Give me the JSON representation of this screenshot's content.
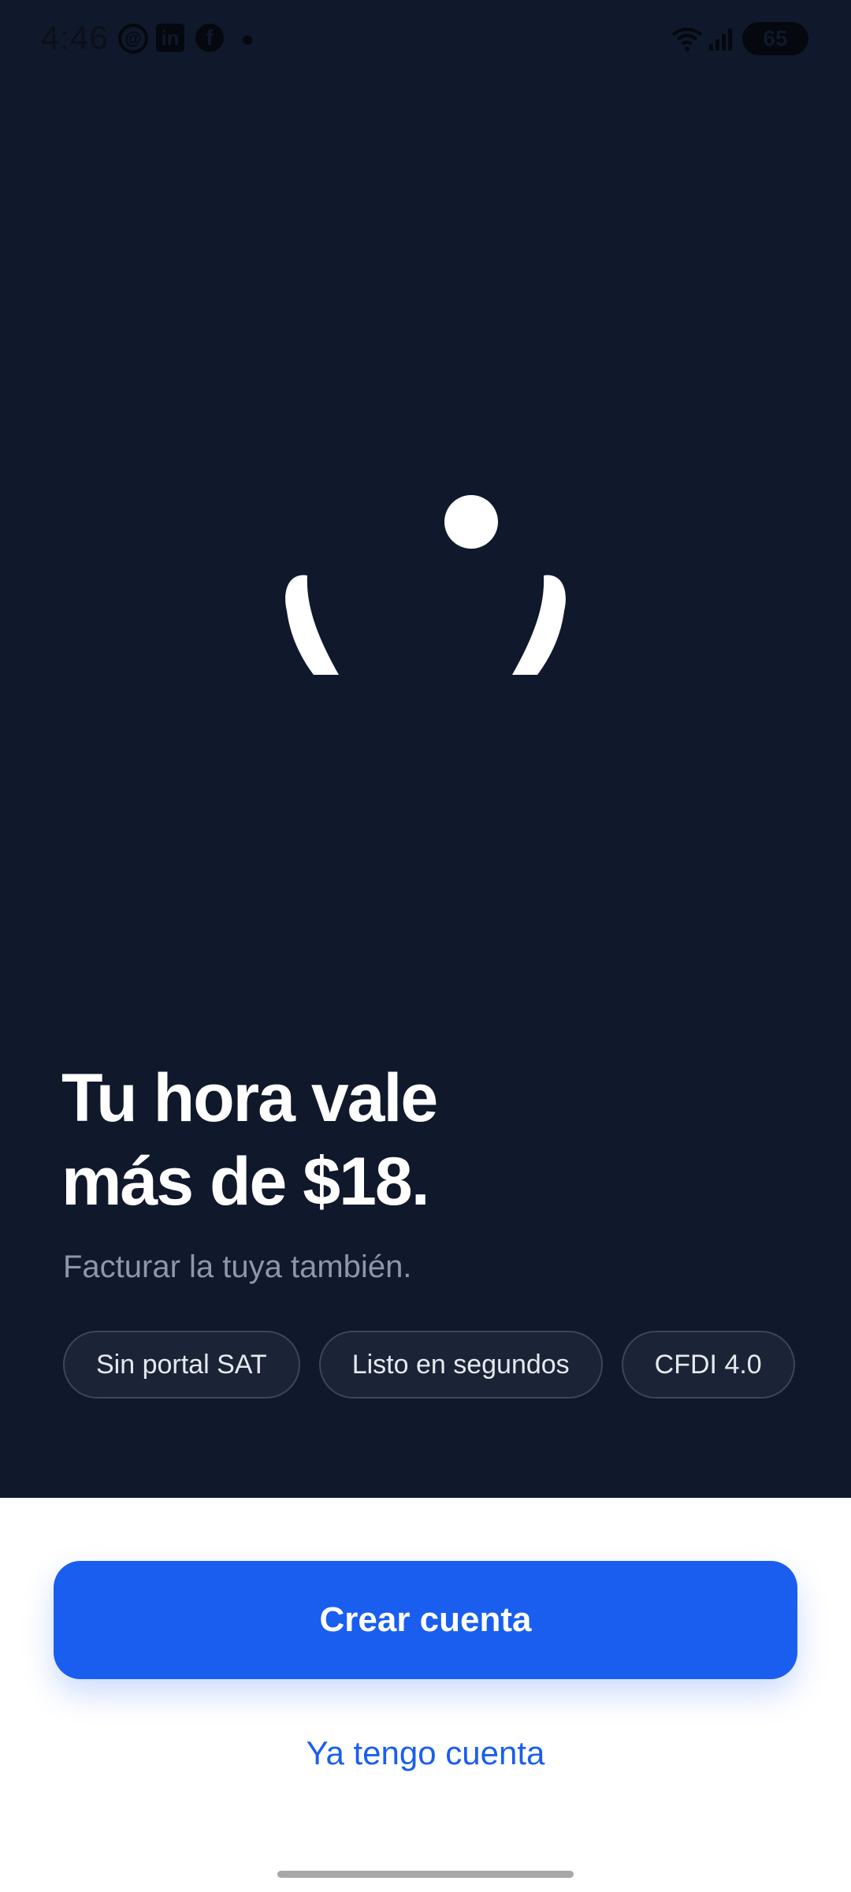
{
  "status_bar": {
    "time": "4:46",
    "battery": "65",
    "icons": [
      "threads-icon",
      "linkedin-icon",
      "facebook-icon",
      "notification-dot",
      "wifi-icon",
      "signal-icon",
      "battery-icon"
    ]
  },
  "hero": {
    "background_color": "#10182b",
    "headline_line1": "Tu hora vale",
    "headline_line2": "más de $18.",
    "subtitle": "Facturar la tuya también.",
    "chips": [
      "Sin portal SAT",
      "Listo en segundos",
      "CFDI 4.0"
    ]
  },
  "actions": {
    "primary_label": "Crear cuenta",
    "secondary_label": "Ya tengo cuenta",
    "accent_color": "#1a5ef0"
  }
}
